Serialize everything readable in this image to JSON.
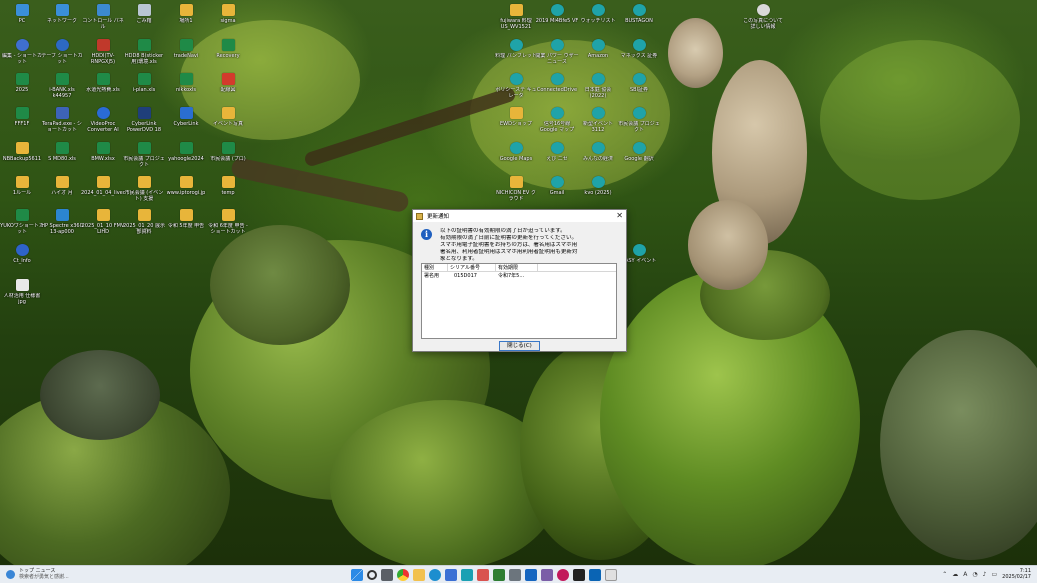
{
  "dialog": {
    "title": "更新通知",
    "close_glyph": "✕",
    "info_glyph": "i",
    "message": [
      "以下の証明書の有効期限の満了日が迫っています。",
      "有効期限の満了日前に証明書の更新を行ってください。",
      "スマホ用電子証明書をお持ちの方は、署名用はスマホ用",
      "署名用、利用者証明用はスマホ用利用者証明用も更新対",
      "象となります。"
    ],
    "columns": [
      "種別",
      "シリアル番号",
      "有効期限"
    ],
    "rows": [
      {
        "type": "署名用",
        "serial": "015D017",
        "expiry": "令和7年5..."
      }
    ],
    "close_button": "閉じる(C)"
  },
  "taskbar": {
    "news_line1": "トップ ニュース",
    "news_line2": "検索者が勇気と感謝...",
    "time": "7:11",
    "date": "2025/02/17",
    "lang": "A"
  },
  "desktop": {
    "col1": [
      "PC",
      "編集 - ショートカット",
      "2025",
      "FFF1F",
      "NBBackup5611",
      "1ルール",
      "YUKOワショートカット",
      "Ct_Info",
      "人材活用 仕様書 jpg"
    ],
    "col2": [
      "ネットワーク",
      "テーブ ショートカット",
      "i-BANK.xls k44957",
      "TeraPad.exe - ショートカット",
      "S MD80.xls",
      "ハイオ 月",
      "HP Spectre x360 13-ap000"
    ],
    "col3": [
      "コントロール パネル",
      "HDDI(TV-RNPGXJ5)",
      "水道光熱費.xls",
      "VideoProc Converter AI",
      "BMW.xlsx",
      "2024_01_04_livedoorBlog",
      "2025_01_10 FMV LIHD"
    ],
    "col4": [
      "ごみ箱",
      "HDD8 B(sticker用)環境.xls",
      "i-plan.xls",
      "CyberLink PowerDVD 18",
      "市民会議 プロジェクト",
      "市民会議 (イベント) 支援",
      "2025_01_20 展示 部資料"
    ],
    "col5": [
      "場所1",
      "tradeNavi",
      "nikkoxls",
      "CyberLink",
      "yahoogle2024",
      "www.iptorogi.jp",
      "令和 5年度 申告"
    ],
    "col6": [
      "sigma",
      "Recovery",
      "配線図",
      "イベント写真",
      "市民会議 (プロ)",
      "temp",
      "令和 6年度 申告 - ショートカット"
    ],
    "col7": [
      "fujiwara 料理 US_WV1521",
      "料理 パンフレット",
      "ポリシーステ キュレータ",
      "EWDショップ",
      "Google Maps",
      "NICHICON EV クラウド"
    ],
    "col8": [
      "2019 Mi4Bfe5 VF",
      "開業 パワー ウザー ニュース",
      "ConnectedDrive",
      "信号16号線 Google マップ",
      "えび ニセ",
      "Gmail"
    ],
    "col9": [
      "ウォッチリスト",
      "Amazon",
      "日本庭 協会 (2022)",
      "新型イベント 3112",
      "みんなの経済",
      "kvo (2025)"
    ],
    "col10": [
      "BUSTAGON",
      "マネックス 証券",
      "SBI証券",
      "市民会議 プロジェクト",
      "Google 翻訳",
      "EASY イベント"
    ],
    "col11": [
      "この写真について 詳しい情報"
    ]
  }
}
